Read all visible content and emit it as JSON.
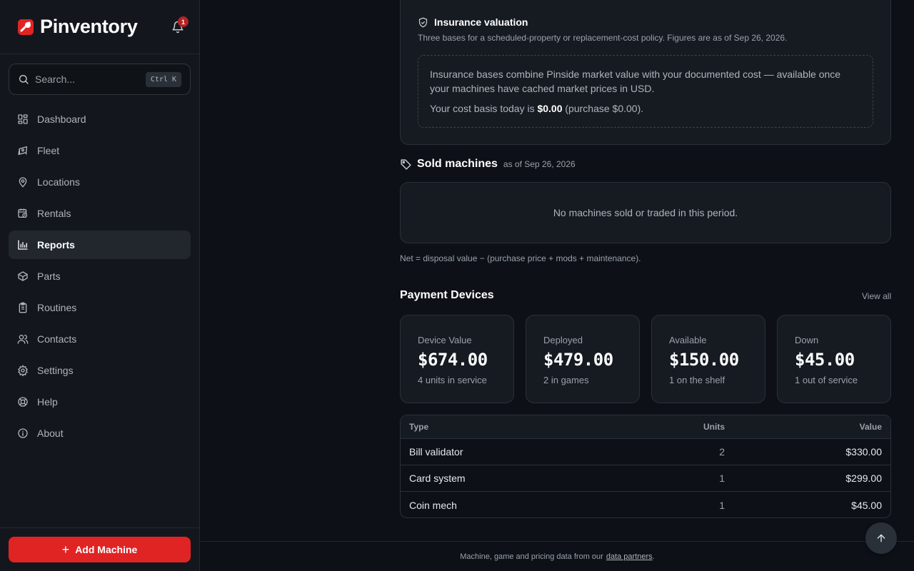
{
  "brand": {
    "name": "Pinventory",
    "accent": "#e02424"
  },
  "notifications": {
    "count": "1"
  },
  "search": {
    "placeholder": "Search...",
    "shortcut": "Ctrl K"
  },
  "nav": [
    {
      "label": "Dashboard",
      "icon": "dashboard-icon"
    },
    {
      "label": "Fleet",
      "icon": "pinball-icon"
    },
    {
      "label": "Locations",
      "icon": "map-pin-icon"
    },
    {
      "label": "Rentals",
      "icon": "calendar-clock-icon"
    },
    {
      "label": "Reports",
      "icon": "bar-chart-icon",
      "active": true
    },
    {
      "label": "Parts",
      "icon": "box-icon"
    },
    {
      "label": "Routines",
      "icon": "clipboard-icon"
    },
    {
      "label": "Contacts",
      "icon": "users-icon"
    },
    {
      "label": "Settings",
      "icon": "gear-icon"
    },
    {
      "label": "Help",
      "icon": "lifebuoy-icon"
    },
    {
      "label": "About",
      "icon": "info-icon"
    }
  ],
  "add_machine": {
    "label": "Add Machine"
  },
  "insurance": {
    "title": "Insurance valuation",
    "subtitle": "Three bases for a scheduled-property or replacement-cost policy. Figures are as of Sep 26, 2026.",
    "note": "Insurance bases combine Pinside market value with your documented cost — available once your machines have cached market prices in USD.",
    "cost_prefix": "Your cost basis today is",
    "cost_value": "$0.00",
    "cost_suffix": "(purchase $0.00)."
  },
  "sold": {
    "title": "Sold machines",
    "as_of": "as of Sep 26, 2026",
    "empty": "No machines sold or traded in this period.",
    "net_note": "Net = disposal value − (purchase price + mods + maintenance)."
  },
  "payment_devices": {
    "title": "Payment Devices",
    "view_all": "View all",
    "stats": [
      {
        "label": "Device Value",
        "value": "$674.00",
        "sub": "4 units in service"
      },
      {
        "label": "Deployed",
        "value": "$479.00",
        "sub": "2 in games"
      },
      {
        "label": "Available",
        "value": "$150.00",
        "sub": "1 on the shelf"
      },
      {
        "label": "Down",
        "value": "$45.00",
        "sub": "1 out of service"
      }
    ],
    "table": {
      "headers": {
        "type": "Type",
        "units": "Units",
        "value": "Value"
      },
      "rows": [
        {
          "type": "Bill validator",
          "units": "2",
          "value": "$330.00"
        },
        {
          "type": "Card system",
          "units": "1",
          "value": "$299.00"
        },
        {
          "type": "Coin mech",
          "units": "1",
          "value": "$45.00"
        }
      ]
    }
  },
  "footer": {
    "text": "Machine, game and pricing data from our",
    "link": "data partners",
    "end": "."
  }
}
